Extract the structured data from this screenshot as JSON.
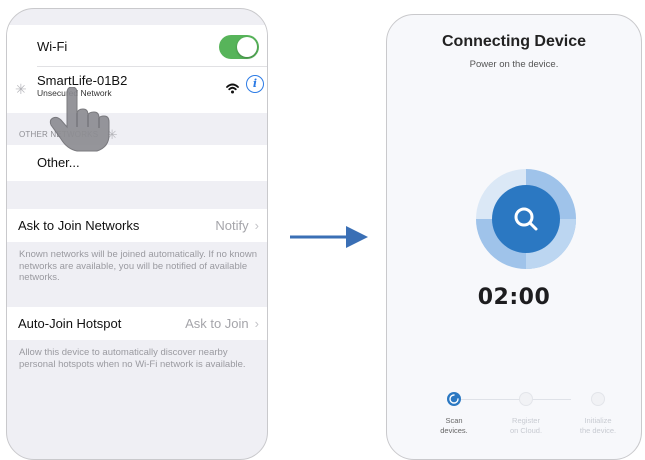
{
  "wifi_settings": {
    "wifi_label": "Wi-Fi",
    "wifi_enabled": true,
    "current_network": {
      "name": "SmartLife-01B2",
      "subtitle": "Unsecured Network"
    },
    "other_networks_header": "OTHER NETWORKS",
    "other_label": "Other...",
    "ask_to_join": {
      "label": "Ask to Join Networks",
      "value": "Notify",
      "footnote": "Known networks will be joined automatically. If no known networks are available, you will be notified of available networks."
    },
    "auto_join_hotspot": {
      "label": "Auto-Join Hotspot",
      "value": "Ask to Join",
      "footnote": "Allow this device to automatically discover nearby personal hotspots when no Wi-Fi network is available."
    }
  },
  "connecting": {
    "title": "Connecting Device",
    "subtitle": "Power on the device.",
    "timer": "02:00",
    "steps": [
      {
        "line1": "Scan",
        "line2": "devices.",
        "state": "active"
      },
      {
        "line1": "Register",
        "line2": "on Cloud.",
        "state": "pending"
      },
      {
        "line1": "Initialize",
        "line2": "the device.",
        "state": "pending"
      }
    ]
  },
  "colors": {
    "toggle_on": "#57b45a",
    "info_blue": "#2c7be5",
    "arrow_blue": "#3a6fb5",
    "accent_blue": "#2b78c2"
  },
  "icons": {
    "wifi_signal": "wifi-icon",
    "info": "info-icon",
    "spinner": "spinner-icon",
    "chevron": "chevron-right-icon",
    "hand": "pointing-hand-icon",
    "search": "search-icon",
    "arrow": "arrow-right-icon"
  }
}
